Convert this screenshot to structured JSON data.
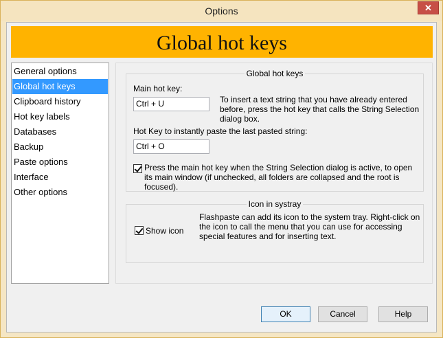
{
  "window": {
    "title": "Options",
    "close_symbol": "✕"
  },
  "banner": {
    "title": "Global hot keys",
    "color": "#ffb300"
  },
  "nav": {
    "items": [
      {
        "label": "General options",
        "selected": false
      },
      {
        "label": "Global hot keys",
        "selected": true
      },
      {
        "label": "Clipboard history",
        "selected": false
      },
      {
        "label": "Hot key labels",
        "selected": false
      },
      {
        "label": "Databases",
        "selected": false
      },
      {
        "label": "Backup",
        "selected": false
      },
      {
        "label": "Paste options",
        "selected": false
      },
      {
        "label": "Interface",
        "selected": false
      },
      {
        "label": "Other options",
        "selected": false
      }
    ]
  },
  "hotkeys_group": {
    "title": "Global hot keys",
    "main_label": "Main hot key:",
    "main_value": "Ctrl + U",
    "main_description": "To insert a text string that you have already entered before, press the hot key that calls the String Selection dialog box.",
    "paste_label": "Hot Key to instantly paste the last pasted string:",
    "paste_value": "Ctrl + O",
    "checkbox_label": "Press the main hot key when the String Selection dialog is active, to open its main window (if unchecked, all folders are collapsed and the root is focused).",
    "checkbox_checked": true
  },
  "systray_group": {
    "title": "Icon in systray",
    "checkbox_label": "Show icon",
    "checkbox_checked": true,
    "description": "Flashpaste can add its icon to the system tray. Right-click on the icon to call the menu that you can use for accessing special features and for inserting text."
  },
  "buttons": {
    "ok": "OK",
    "cancel": "Cancel",
    "help": "Help"
  }
}
